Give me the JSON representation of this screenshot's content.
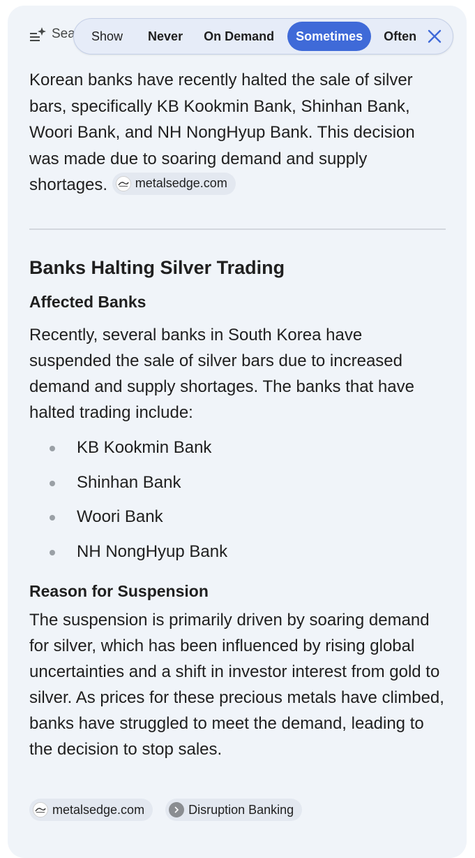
{
  "header": {
    "search_label": "Search"
  },
  "frequency": {
    "show_label": "Show",
    "options": [
      "Never",
      "On Demand",
      "Sometimes",
      "Often"
    ],
    "selected": "Sometimes"
  },
  "intro": {
    "text": "Korean banks have recently halted the sale of silver bars, specifically KB Kookmin Bank, Shinhan Bank, Woori Bank, and NH NongHyup Bank. This decision was made due to soaring demand and supply shortages.",
    "source": "metalsedge.com"
  },
  "section": {
    "title": "Banks Halting Silver Trading",
    "affected": {
      "heading": "Affected Banks",
      "paragraph": "Recently, several banks in South Korea have suspended the sale of silver bars due to increased demand and supply shortages. The banks that have halted trading include:",
      "banks": [
        "KB Kookmin Bank",
        "Shinhan Bank",
        "Woori Bank",
        "NH NongHyup Bank"
      ]
    },
    "reason": {
      "heading": "Reason for Suspension",
      "paragraph": "The suspension is primarily driven by soaring demand for silver, which has been influenced by rising global uncertainties and a shift in investor interest from gold to silver. As prices for these precious metals have climbed, banks have struggled to meet the demand, leading to the decision to stop sales."
    }
  },
  "sources": [
    {
      "label": "metalsedge.com",
      "icon": "metalsedge-logo-icon"
    },
    {
      "label": "Disruption Banking",
      "icon": "chevron-right-icon"
    }
  ],
  "colors": {
    "card_background": "#f0f4f9",
    "selected_option": "#3f6ad8",
    "close_icon": "#3f6ad8"
  }
}
